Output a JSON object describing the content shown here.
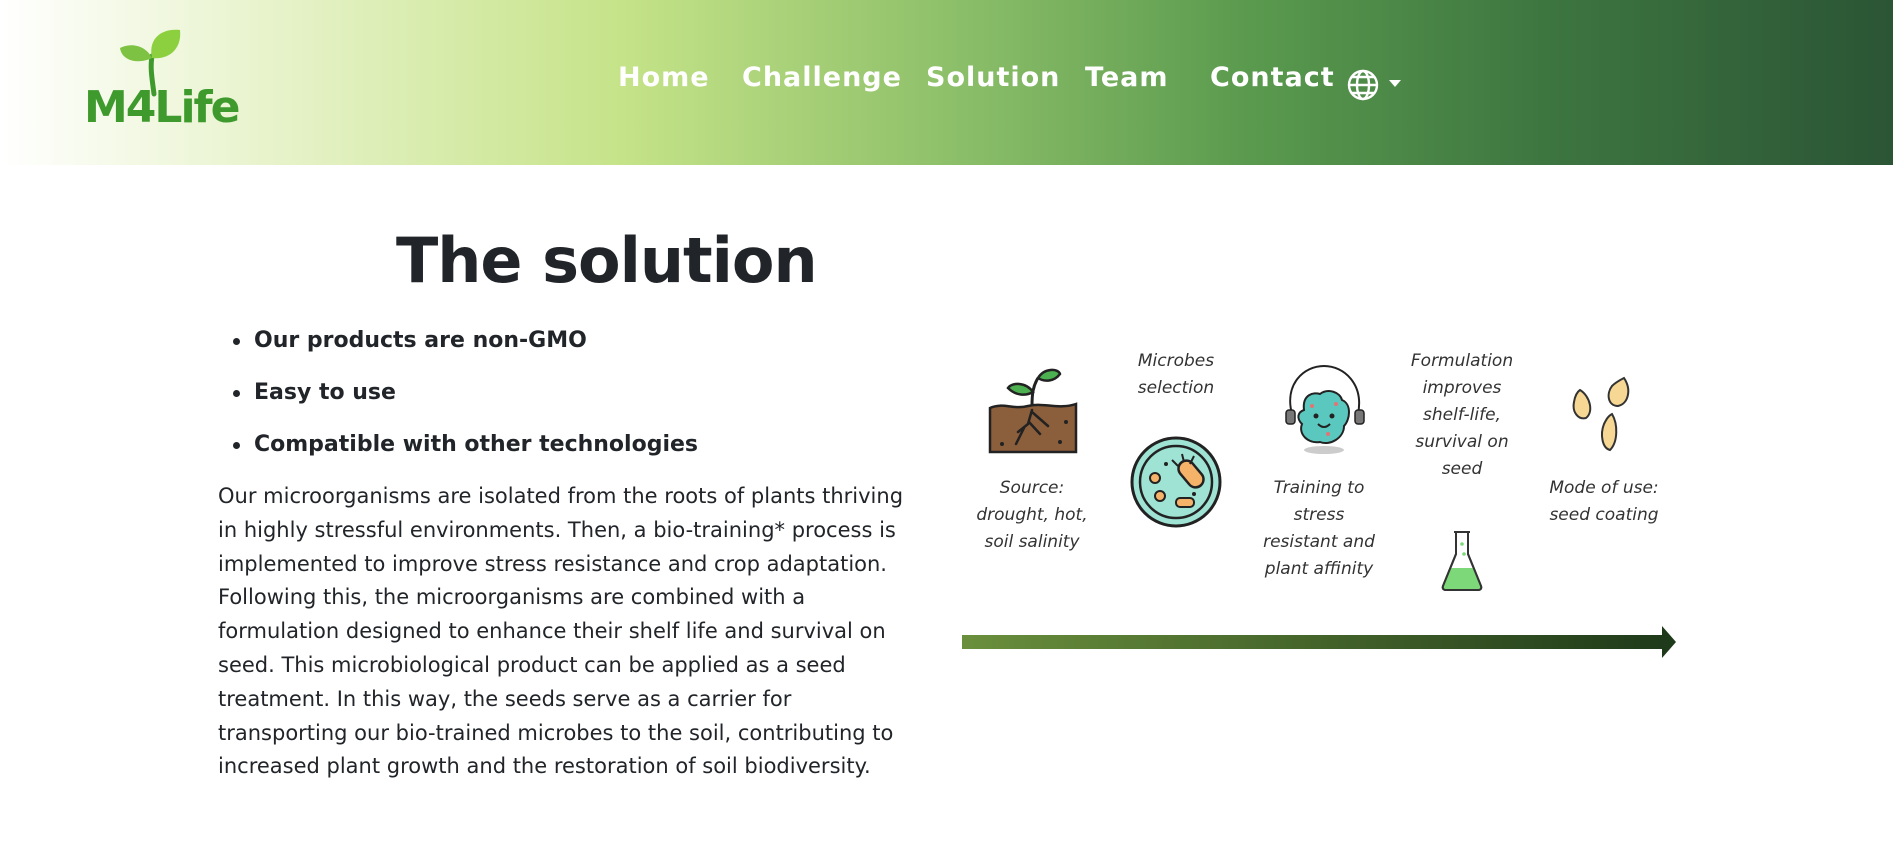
{
  "header": {
    "logo_text": "M4Life",
    "nav": [
      "Home",
      "Challenge",
      "Solution",
      "Team",
      "Contact"
    ],
    "language_icon": "globe-icon"
  },
  "main": {
    "title": "The solution",
    "bullets": [
      "Our products are non-GMO",
      "Easy to use",
      "Compatible with other technologies"
    ],
    "paragraph": "Our microorganisms are isolated from the roots of plants thriving in highly stressful environments. Then, a bio-training* process is implemented to improve stress resistance and crop adaptation. Following this, the microorganisms are combined with a formulation designed to enhance their shelf life and survival on seed. This microbiological product can be applied as a seed treatment. In this way, the seeds serve as a carrier for transporting our bio-trained microbes to the soil, contributing to increased plant growth and the restoration of soil biodiversity."
  },
  "process": {
    "steps": [
      {
        "icon": "sprout-icon",
        "label": "Source: drought, hot, soil salinity"
      },
      {
        "icon": "bacteria-dish-icon",
        "label": "Microbes selection"
      },
      {
        "icon": "training-microbe-icon",
        "label": "Training to stress resistant and plant affinity"
      },
      {
        "icon": "flask-icon",
        "label": "Formulation improves shelf-life, survival on seed"
      },
      {
        "icon": "seeds-icon",
        "label": "Mode of use: seed coating"
      }
    ],
    "arrow_icon": "arrow-right-icon"
  },
  "colors": {
    "brand_green": "#3f9a2e",
    "header_dark": "#2b5535",
    "text": "#212529"
  }
}
